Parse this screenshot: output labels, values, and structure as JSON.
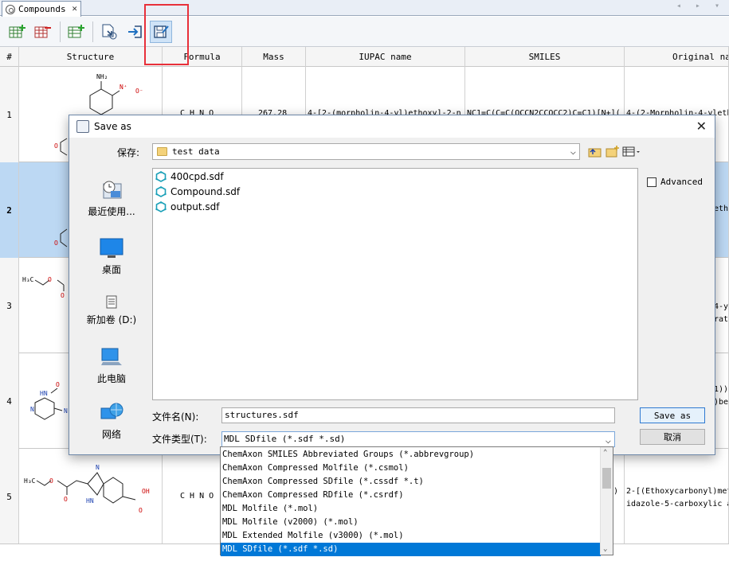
{
  "tab": {
    "label": "Compounds",
    "close": "✕"
  },
  "scroll_arrows": "◂ ▸ ▾",
  "toolbar": {
    "buttons": [
      "add-table",
      "remove-table",
      "add-table-2",
      "open",
      "import",
      "save-as"
    ]
  },
  "grid": {
    "headers": [
      "#",
      "Structure",
      "Formula",
      "Mass",
      "IUPAC name",
      "SMILES",
      "Original nam"
    ],
    "rows": [
      {
        "num": "1",
        "formula": "C  H  N O",
        "mass": "267.28",
        "iupac": "4-[2-(morpholin-4-yl)ethoxy]-2-n",
        "smiles": "NC1=C(C=C(OCCN2CCOCC2)C=C1)[N+](",
        "original": "4-(2-Morpholin-4-yleth"
      },
      {
        "num": "2",
        "formula": "",
        "mass": "",
        "iupac": "",
        "smiles": "",
        "original": "eth"
      },
      {
        "num": "3",
        "formula": "",
        "mass": "",
        "iupac": "",
        "smiles": "",
        "original": "4-yl",
        "original2": "rate"
      },
      {
        "num": "4",
        "formula": "",
        "mass": "",
        "iupac": "",
        "smiles": "",
        "original": "1))",
        "original2": ")be"
      },
      {
        "num": "5",
        "formula": "C  H  N O",
        "mass": "",
        "iupac": "",
        "smiles": ")",
        "original": "2-[(Ethoxycarbonyl)met",
        "original2": "idazole-5-carboxylic a"
      }
    ],
    "structure_labels": {
      "r1": [
        "NH₂",
        "N⁺",
        "O⁻",
        "O",
        "O"
      ],
      "r3": [
        "H₃C",
        "O",
        "O"
      ],
      "r4": [
        "HN",
        "O",
        "N",
        "N"
      ],
      "r5": [
        "H₃C",
        "O",
        "O",
        "N",
        "HN",
        "OH",
        "O"
      ]
    }
  },
  "dialog": {
    "title": "Save as",
    "close": "✕",
    "look_in_label": "保存:",
    "look_in_value": "test data",
    "places": [
      "最近使用...",
      "桌面",
      "新加卷 (D:)",
      "此电脑",
      "网络"
    ],
    "files": [
      "400cpd.sdf",
      "Compound.sdf",
      "output.sdf"
    ],
    "advanced_label": "Advanced",
    "filename_label": "文件名(N):",
    "filename_value": "structures.sdf",
    "filetype_label": "文件类型(T):",
    "filetype_value": "MDL SDfile (*.sdf *.sd)",
    "save_button": "Save as",
    "cancel_button": "取消"
  },
  "filetype_options": [
    "ChemAxon SMILES Abbreviated Groups (*.abbrevgroup)",
    "ChemAxon Compressed Molfile (*.csmol)",
    "ChemAxon Compressed SDfile (*.cssdf *.t)",
    "ChemAxon Compressed RDfile (*.csrdf)",
    "MDL Molfile (*.mol)",
    "MDL Molfile (v2000) (*.mol)",
    "MDL Extended Molfile (v3000) (*.mol)",
    "MDL SDfile (*.sdf *.sd)"
  ],
  "colors": {
    "accent": "#0078d7",
    "selected_row": "#bcd8f3",
    "highlight": "#e8303a"
  }
}
